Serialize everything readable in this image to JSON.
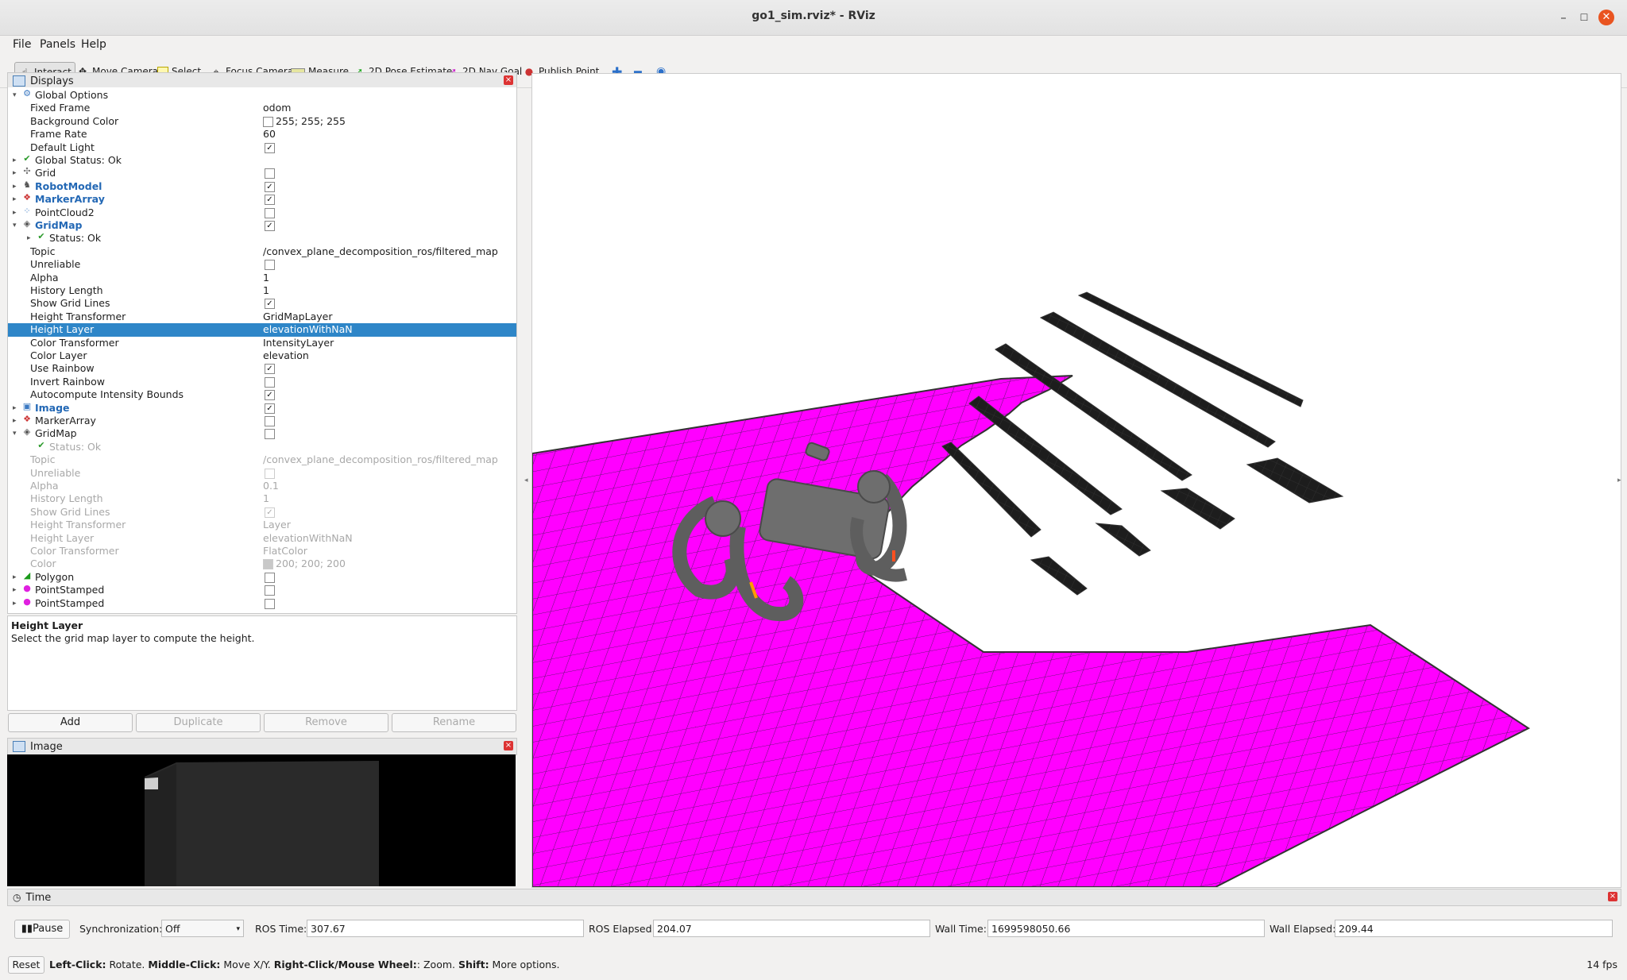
{
  "window": {
    "title": "go1_sim.rviz* - RViz"
  },
  "menu": {
    "file": "File",
    "panels": "Panels",
    "help": "Help"
  },
  "toolbar": {
    "interact": "Interact",
    "move_camera": "Move Camera",
    "select": "Select",
    "focus_camera": "Focus Camera",
    "measure": "Measure",
    "pose_estimate": "2D Pose Estimate",
    "nav_goal": "2D Nav Goal",
    "publish_point": "Publish Point"
  },
  "displays": {
    "title": "Displays",
    "rows": [
      {
        "name": "Global Options",
        "value": ""
      },
      {
        "name": "Fixed Frame",
        "value": "odom"
      },
      {
        "name": "Background Color",
        "value": "255; 255; 255"
      },
      {
        "name": "Frame Rate",
        "value": "60"
      },
      {
        "name": "Default Light",
        "value": ""
      },
      {
        "name": "Global Status: Ok",
        "value": ""
      },
      {
        "name": "Grid",
        "value": ""
      },
      {
        "name": "RobotModel",
        "value": ""
      },
      {
        "name": "MarkerArray",
        "value": ""
      },
      {
        "name": "PointCloud2",
        "value": ""
      },
      {
        "name": "GridMap",
        "value": ""
      },
      {
        "name": "Status: Ok",
        "value": ""
      },
      {
        "name": "Topic",
        "value": "/convex_plane_decomposition_ros/filtered_map"
      },
      {
        "name": "Unreliable",
        "value": ""
      },
      {
        "name": "Alpha",
        "value": "1"
      },
      {
        "name": "History Length",
        "value": "1"
      },
      {
        "name": "Show Grid Lines",
        "value": ""
      },
      {
        "name": "Height Transformer",
        "value": "GridMapLayer"
      },
      {
        "name": "Height Layer",
        "value": "elevationWithNaN"
      },
      {
        "name": "Color Transformer",
        "value": "IntensityLayer"
      },
      {
        "name": "Color Layer",
        "value": "elevation"
      },
      {
        "name": "Use Rainbow",
        "value": ""
      },
      {
        "name": "Invert Rainbow",
        "value": ""
      },
      {
        "name": "Autocompute Intensity Bounds",
        "value": ""
      },
      {
        "name": "Image",
        "value": ""
      },
      {
        "name": "MarkerArray",
        "value": ""
      },
      {
        "name": "GridMap",
        "value": ""
      },
      {
        "name": "Status: Ok",
        "value": ""
      },
      {
        "name": "Topic",
        "value": "/convex_plane_decomposition_ros/filtered_map"
      },
      {
        "name": "Unreliable",
        "value": ""
      },
      {
        "name": "Alpha",
        "value": "0.1"
      },
      {
        "name": "History Length",
        "value": "1"
      },
      {
        "name": "Show Grid Lines",
        "value": ""
      },
      {
        "name": "Height Transformer",
        "value": "Layer"
      },
      {
        "name": "Height Layer",
        "value": "elevationWithNaN"
      },
      {
        "name": "Color Transformer",
        "value": "FlatColor"
      },
      {
        "name": "Color",
        "value": "200; 200; 200"
      },
      {
        "name": "Polygon",
        "value": ""
      },
      {
        "name": "PointStamped",
        "value": ""
      },
      {
        "name": "PointStamped",
        "value": ""
      }
    ],
    "description_title": "Height Layer",
    "description_text": "Select the grid map layer to compute the height.",
    "buttons": {
      "add": "Add",
      "duplicate": "Duplicate",
      "remove": "Remove",
      "rename": "Rename"
    }
  },
  "image_panel": {
    "title": "Image"
  },
  "time_panel": {
    "title": "Time",
    "pause": "Pause",
    "sync_label": "Synchronization:",
    "sync_value": "Off",
    "ros_time_label": "ROS Time:",
    "ros_time": "307.67",
    "ros_elapsed_label": "ROS Elapsed:",
    "ros_elapsed": "204.07",
    "wall_time_label": "Wall Time:",
    "wall_time": "1699598050.66",
    "wall_elapsed_label": "Wall Elapsed:",
    "wall_elapsed": "209.44"
  },
  "status": {
    "reset": "Reset",
    "k1": "Left-Click:",
    "t1": " Rotate. ",
    "k2": "Middle-Click:",
    "t2": " Move X/Y. ",
    "k3": "Right-Click/Mouse Wheel:",
    "t3": ": Zoom. ",
    "k4": "Shift:",
    "t4": " More options.",
    "fps": "14 fps"
  },
  "colors": {
    "magenta": "#ff00ff",
    "selection": "#2e86c8",
    "close": "#e95420"
  }
}
